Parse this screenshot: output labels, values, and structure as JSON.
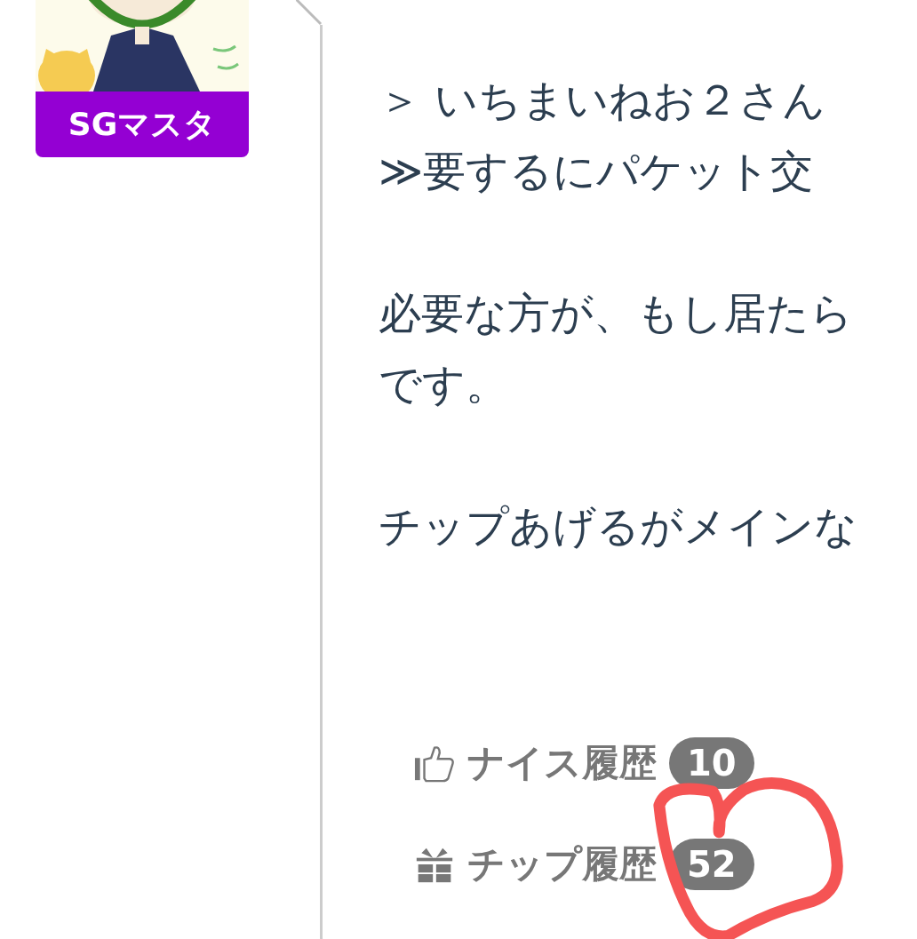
{
  "post": {
    "author_badge": "SGマスタ",
    "paragraphs": [
      [
        "＞ いちまいねお２さん",
        "≫要するにパケット交"
      ],
      [
        "必要な方が、もし居たら",
        "です。"
      ],
      [
        "チップあげるがメインな"
      ]
    ],
    "stats": [
      {
        "kind": "nice",
        "label": "ナイス履歴",
        "count": "10"
      },
      {
        "kind": "tip",
        "label": "チップ履歴",
        "count": "52"
      }
    ]
  },
  "annotation": {
    "kind": "heart"
  }
}
